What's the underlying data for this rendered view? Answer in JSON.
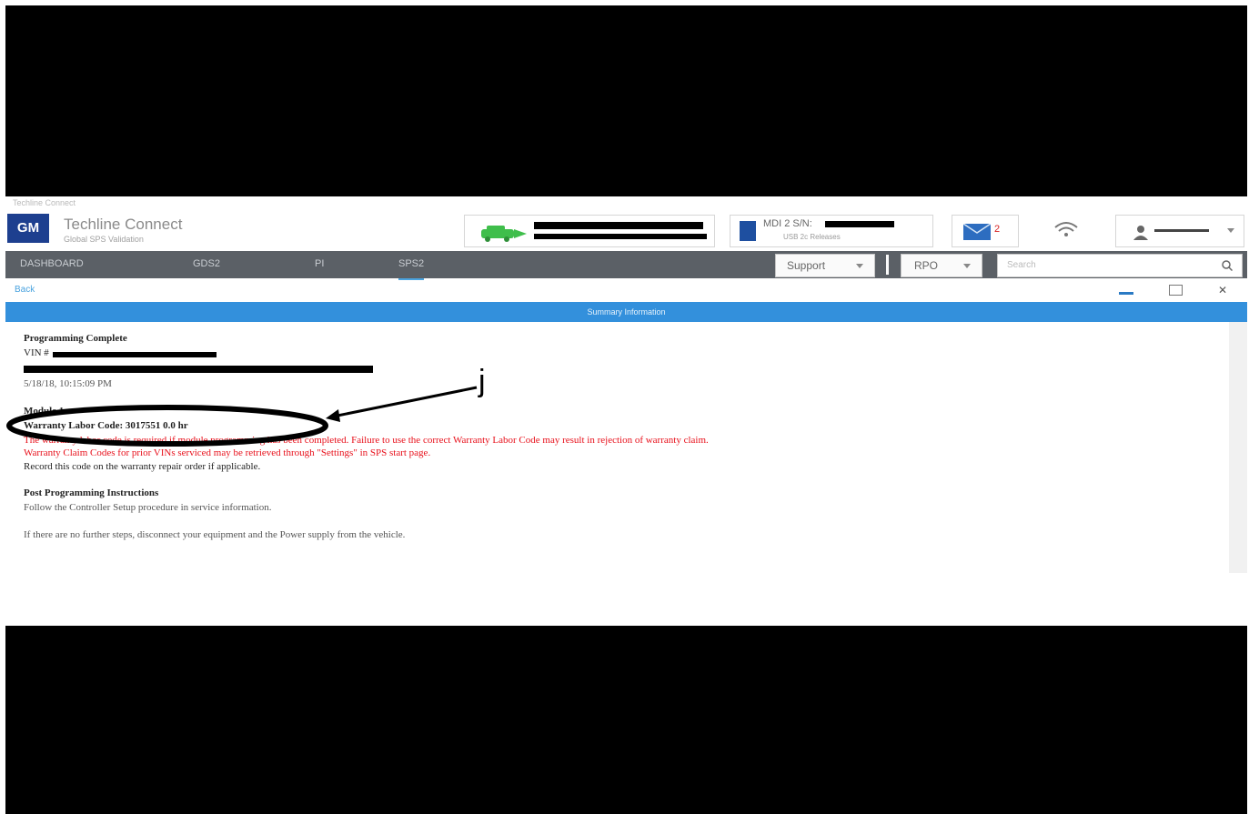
{
  "window": {
    "caption": "Techline Connect"
  },
  "header": {
    "logo": "GM",
    "app_title": "Techline Connect",
    "app_subtitle": "Global SPS Validation",
    "device": {
      "title": "MDI 2 S/N:",
      "subtitle": "USB 2c Releases"
    },
    "mail_count": "2"
  },
  "nav": {
    "tabs": [
      "DASHBOARD",
      "GDS2",
      "PI",
      "SPS2"
    ],
    "active_tab": "SPS2",
    "support_label": "Support",
    "rpo_label": "RPO",
    "search_placeholder": "Search"
  },
  "subbar": {
    "back_label": "Back"
  },
  "panel": {
    "title": "Summary Information"
  },
  "summary": {
    "heading": "Programming Complete",
    "vin_label": "VIN #",
    "timestamp": "5/18/18, 10:15:09 PM",
    "module_heading": "Module 1",
    "warranty_code": "Warranty Labor Code: 3017551 0.0 hr",
    "red_line_1": "The warranty labor code is required if module programming has been completed. Failure to use the correct Warranty Labor Code may result in rejection of warranty claim.",
    "red_line_2": "Warranty Claim Codes for prior VINs serviced may be retrieved through \"Settings\" in SPS start page.",
    "record_note": "Record this code on the warranty repair order if applicable.",
    "post_heading": "Post Programming Instructions",
    "post_line": "Follow the Controller Setup procedure in service information.",
    "footer_note": "If there are no further steps, disconnect your equipment and the Power supply from the vehicle.",
    "annotation_label": "j"
  },
  "colors": {
    "accent": "#3390dc",
    "navbar": "#5b6066",
    "warning_text": "#e8101b",
    "logo": "#1d3f8f"
  },
  "icons": [
    "car-icon",
    "device-icon",
    "mail-icon",
    "wifi-icon",
    "user-icon",
    "chevron-down-icon",
    "search-icon",
    "minimize-icon",
    "maximize-icon",
    "close-icon"
  ]
}
